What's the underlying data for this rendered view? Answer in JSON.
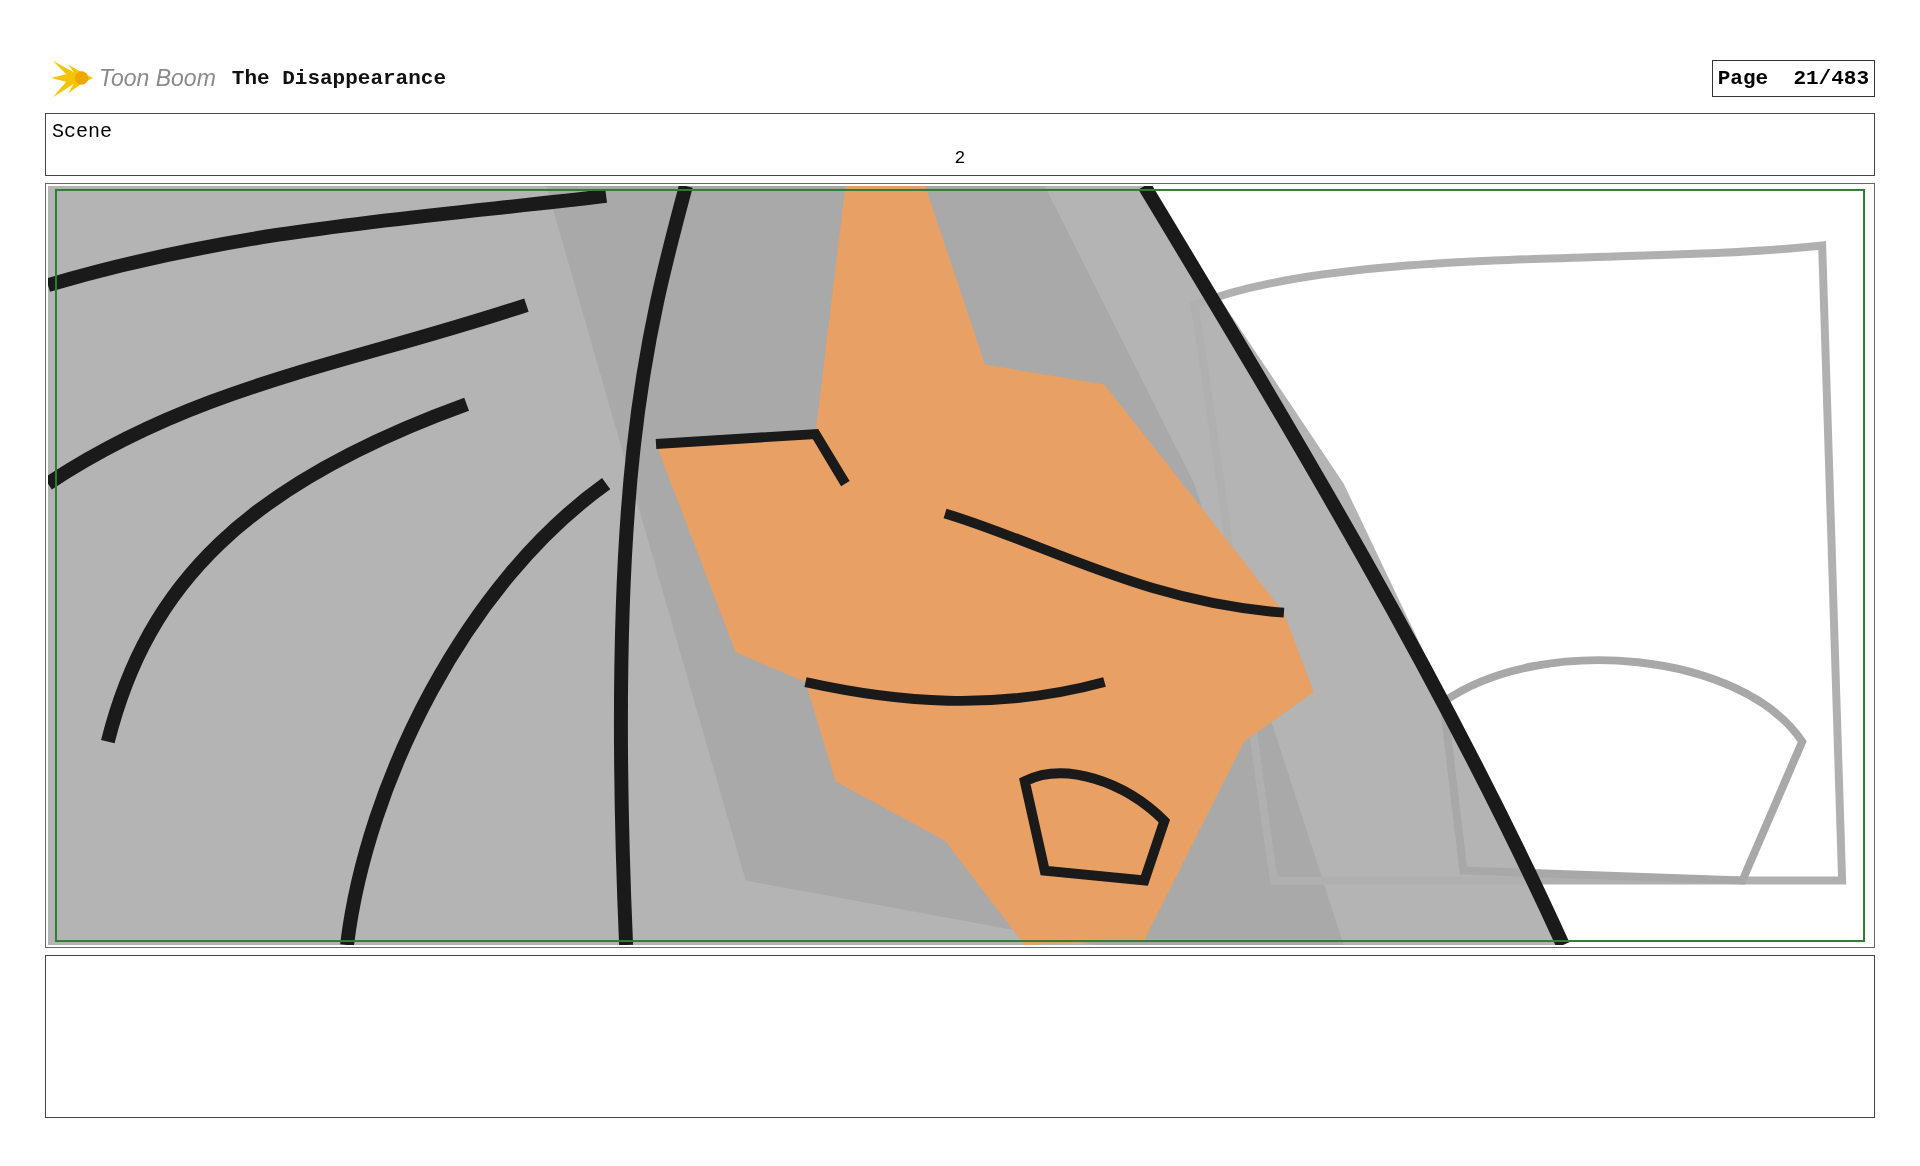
{
  "header": {
    "logo_text": "Toon Boom",
    "title": "The Disappearance",
    "page_label": "Page",
    "page_number": "21/483"
  },
  "scene": {
    "label": "Scene",
    "number": "2"
  }
}
